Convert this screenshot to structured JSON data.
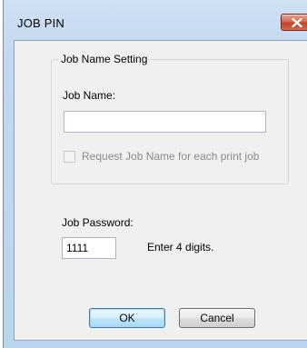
{
  "window": {
    "title": "JOB PIN"
  },
  "job_name_group": {
    "legend": "Job Name Setting",
    "job_name_label": "Job Name:",
    "job_name_value": "",
    "request_checkbox_label": "Request Job Name for each print job",
    "request_checkbox_checked": false,
    "request_checkbox_enabled": false
  },
  "password": {
    "label": "Job Password:",
    "value": "1111",
    "hint": "Enter 4 digits."
  },
  "buttons": {
    "ok": "OK",
    "cancel": "Cancel"
  },
  "icons": {
    "close": "close-x-icon"
  },
  "colors": {
    "frame": "#c3d8ef",
    "client": "#f0f0f0",
    "close_button": "#c0442a",
    "default_button_border": "#3c7fb1"
  }
}
